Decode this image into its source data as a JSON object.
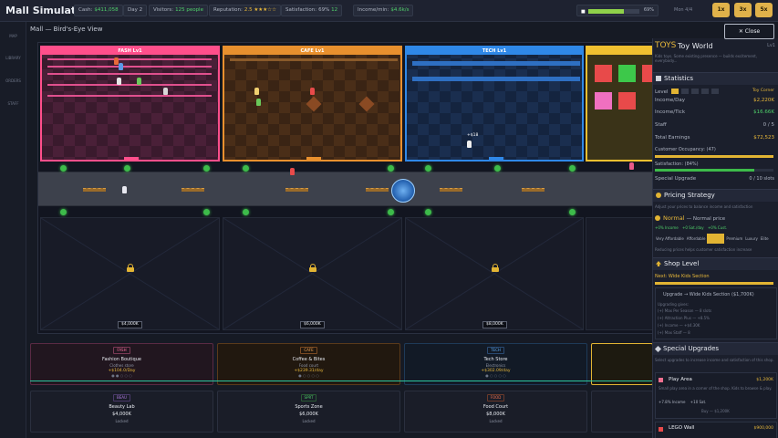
{
  "topbar": {
    "title": "Mall Simulator",
    "cash_label": "Cash:",
    "cash_value": "$411,058",
    "day": "Day 2",
    "visitors_label": "Visitors:",
    "visitors_value": "125 people",
    "reputation_label": "Reputation:",
    "reputation_value": "2.5",
    "reputation_stars": "★★★☆☆",
    "satisfaction_label": "Satisfaction:",
    "satisfaction_value": "69%",
    "satisfaction_extra": "12",
    "income_label": "Income/min:",
    "income_value": "$4.6k/s",
    "progress_pct": "69%",
    "progress_fraction": 0.69,
    "speed_label": "Mon 4/4",
    "speed_buttons": [
      "1x",
      "3x",
      "5x"
    ]
  },
  "leftnav": [
    "MAP",
    "LIBRARY",
    "ORDERS",
    "STAFF"
  ],
  "view_title": "Mall — Bird's-Eye View",
  "shops": [
    {
      "title": "FASH Lv1"
    },
    {
      "title": "CAFE Lv1"
    },
    {
      "title": "TECH Lv1"
    }
  ],
  "tech_float": "+$18",
  "lots": [
    "$4,000K",
    "$6,000K",
    "$8,000K"
  ],
  "cards": [
    {
      "tag": "FASH",
      "name": "Fashion Boutique",
      "sub": "Clothes store",
      "rate": "+$104.0/Day",
      "dots": "● ● ○ ○ ○"
    },
    {
      "tag": "CAFE",
      "name": "Coffee & Bites",
      "sub": "Food court",
      "rate": "+$239.31/day",
      "dots": "● ○ ○ ○ ○"
    },
    {
      "tag": "TECH",
      "name": "Tech Store",
      "sub": "Electronics",
      "rate": "+$302.09/day",
      "dots": "● ○ ○ ○ ○"
    },
    {
      "tag": "BEAU",
      "name": "Beauty Lab",
      "price": "$4,000K",
      "status": "Locked"
    },
    {
      "tag": "SPRT",
      "name": "Sports Zone",
      "price": "$6,000K",
      "status": "Locked"
    },
    {
      "tag": "FOOD",
      "name": "Food Court",
      "price": "$8,000K",
      "status": "Locked"
    }
  ],
  "panel": {
    "close_label": "Close",
    "shop_tag": "TOYS",
    "shop_name": "Toy World",
    "shop_level": "Lv1",
    "shop_desc": "Kids toys. Some existing presence — builds excitement, everybody...",
    "statistics_title": "Statistics",
    "level_label": "Level",
    "level_name": "Toy Corner",
    "income_day_label": "Income/Day",
    "income_day_value": "$2,220K",
    "income_tick_label": "Income/Tick",
    "income_tick_value": "$16.66K",
    "staff_label": "Staff",
    "staff_value": "0 / 5",
    "earnings_label": "Total Earnings",
    "earnings_value": "$72,523",
    "occupancy_label": "Customer Occupancy: (47)",
    "satisfaction_label": "Satisfaction: (84%)",
    "special_label": "Special Upgrade",
    "special_value": "0 / 10 slots",
    "pricing_title": "Pricing Strategy",
    "pricing_desc": "Adjust your prices to balance income and satisfaction",
    "pricing_current": "Normal",
    "pricing_current_desc": "— Normal price",
    "pricing_effects": [
      "+0% Income",
      "+0 Sat./day",
      "+0% Cust."
    ],
    "price_options": [
      "Very Affordable",
      "Affordable",
      "",
      "Premium",
      "Luxury",
      "Elite"
    ],
    "pricing_hint": "Reducing prices helps customer satisfaction increase",
    "shoplevel_title": "Shop Level",
    "next_label": "Next: Wide Kids Section",
    "upgrade_label": "Upgrade → Wide Kids Section ($1,700K)",
    "upgrade_sub": "Upgrading gives:",
    "upgrade_lines": [
      "(+) Max Per Season — 8 slots",
      "(+) Attraction Plus — +8.5%",
      "(+) Income — +$4.30K",
      "(+) Max Staff — 8"
    ],
    "special_upgrades_title": "Special Upgrades",
    "special_upgrades_desc": "Select upgrades to increase income and satisfaction of this shop.",
    "upgrade_items": [
      {
        "name": "Play Area",
        "price": "$1,200K",
        "desc": "Small play area in a corner of the shop. Kids to browse & play.",
        "effects": [
          "+7.8% Income",
          "+10 Sat."
        ],
        "cost": "Buy — $1,200K"
      },
      {
        "name": "LEGO Wall",
        "price": "$900,000"
      }
    ]
  },
  "colors": {
    "fashion": "#ff4f8b",
    "cafe": "#e8902e",
    "tech": "#2f88e8",
    "toys": "#f0c030",
    "accent": "#e2b433",
    "ok": "#3dbb4a"
  }
}
